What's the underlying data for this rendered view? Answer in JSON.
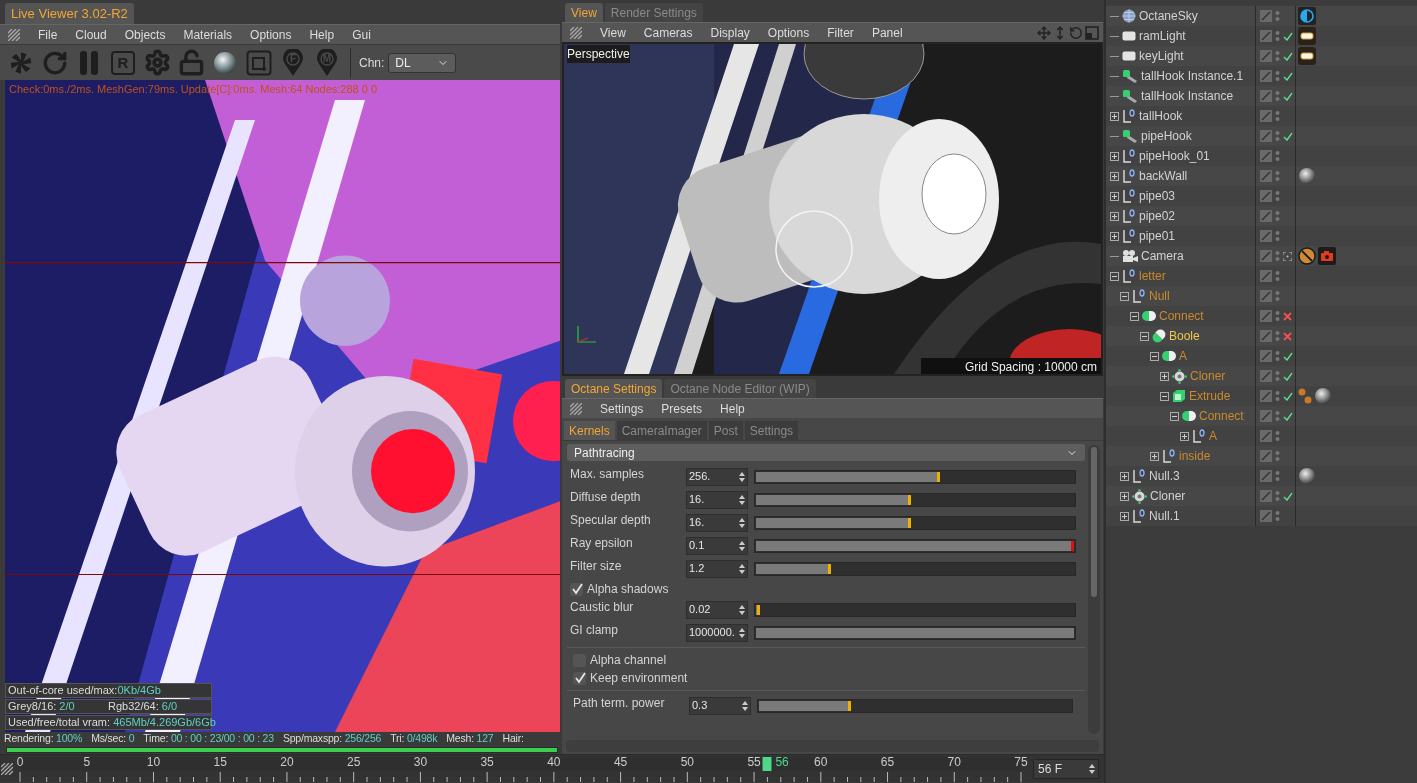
{
  "live_viewer": {
    "tab": {
      "label": "Live Viewer 3.02-R2",
      "selected": true
    },
    "menu": [
      "File",
      "Cloud",
      "Objects",
      "Materials",
      "Options",
      "Help",
      "Gui"
    ],
    "toolbar": [
      {
        "kind": "aperture"
      },
      {
        "kind": "reload"
      },
      {
        "kind": "pause"
      },
      {
        "kind": "letter-box",
        "glyph": "R"
      },
      {
        "kind": "gear"
      },
      {
        "kind": "lock"
      },
      {
        "kind": "sphere"
      },
      {
        "kind": "region"
      },
      {
        "kind": "pin",
        "glyph": "F"
      },
      {
        "kind": "pin",
        "glyph": "M"
      }
    ],
    "channel": {
      "label": "Chn:",
      "value": "DL"
    },
    "overlay": "Check:0ms./2ms. MeshGen:79ms. Update[C]:0ms. Mesh:64 Nodes:288  0 0",
    "stats": [
      [
        {
          "label": "Out-of-core used/max:",
          "value": "0Kb/4Gb"
        }
      ],
      [
        {
          "label": "Grey8/16: ",
          "value": "2/0"
        },
        {
          "label": "Rgb32/64: ",
          "value": "6/0"
        }
      ],
      [
        {
          "label": "Used/free/total vram: ",
          "value": "465Mb/4.269Gb/6Gb"
        }
      ]
    ],
    "status": [
      {
        "label": "Rendering: ",
        "value": "100%"
      },
      {
        "label": "Ms/sec: ",
        "value": "0"
      },
      {
        "label": "Time: ",
        "value": "00 : 00 : 23/00 : 00 : 23"
      },
      {
        "label": "Spp/maxspp: ",
        "value": "256/256"
      },
      {
        "label": "Tri: ",
        "value": "0/498k"
      },
      {
        "label": "Mesh: ",
        "value": "127"
      },
      {
        "label": "Hair:"
      }
    ],
    "progress": {
      "level": 1
    }
  },
  "viewport": {
    "tabs": [
      {
        "label": "View",
        "selected": true
      },
      {
        "label": "Render Settings",
        "selected": false
      }
    ],
    "menu": [
      "View",
      "Cameras",
      "Display",
      "Options",
      "Filter",
      "Panel"
    ],
    "camera": "Perspective",
    "grid": "Grid Spacing : 10000 cm"
  },
  "octane": {
    "tabs": [
      {
        "label": "Octane Settings",
        "selected": true
      },
      {
        "label": "Octane Node Editor (WIP)",
        "selected": false
      }
    ],
    "menu": [
      "Settings",
      "Presets",
      "Help"
    ],
    "subtabs": [
      {
        "label": "Kernels",
        "selected": true
      },
      {
        "label": "CameraImager",
        "selected": false
      },
      {
        "label": "Post",
        "selected": false
      },
      {
        "label": "Settings",
        "selected": false
      }
    ],
    "kernel": "Pathtracing",
    "sections": [
      [
        {
          "kind": "slider",
          "label": "Max. samples",
          "value": "256.",
          "level": 0.58,
          "color": "#f0b000"
        },
        {
          "kind": "slider",
          "label": "Diffuse depth",
          "value": "16.",
          "level": 0.49,
          "color": "#f0b000"
        },
        {
          "kind": "slider",
          "label": "Specular depth",
          "value": "16.",
          "level": 0.49,
          "color": "#f0b000"
        },
        {
          "kind": "slider",
          "label": "Ray epsilon",
          "value": "0.1",
          "level": 1,
          "color": "#e01010"
        },
        {
          "kind": "slider",
          "label": "Filter size",
          "value": "1.2",
          "level": 0.24,
          "color": "#f0b000"
        },
        {
          "kind": "checkbox",
          "label": "Alpha shadows",
          "checked": true
        },
        {
          "kind": "slider",
          "label": "Caustic blur",
          "value": "0.02",
          "level": 0.02,
          "color": "#f0b000"
        },
        {
          "kind": "slider",
          "label": "GI clamp",
          "value": "1000000.",
          "level": 1
        }
      ],
      [
        {
          "kind": "checkbox",
          "label": "Alpha channel",
          "checked": false
        },
        {
          "kind": "checkbox",
          "label": "Keep environment",
          "checked": true
        }
      ],
      [
        {
          "kind": "slider",
          "label": "Path term. power",
          "value": "0.3",
          "level": 0.3,
          "color": "#f0b000"
        }
      ]
    ]
  },
  "objects": [
    {
      "name": "OctaneSky",
      "kind": "sky",
      "selected": false,
      "active": false,
      "tags": [
        {
          "kind": "sky"
        }
      ]
    },
    {
      "name": "ramLight",
      "kind": "light",
      "selected": false,
      "active": false,
      "status": {
        "kind": "check"
      },
      "tags": [
        {
          "kind": "light"
        }
      ]
    },
    {
      "name": "keyLight",
      "kind": "light",
      "selected": false,
      "active": false,
      "status": {
        "kind": "check"
      },
      "tags": [
        {
          "kind": "light"
        }
      ]
    },
    {
      "name": "tallHook Instance.1",
      "kind": "instance",
      "selected": false,
      "active": false,
      "status": {
        "kind": "check"
      }
    },
    {
      "name": "tallHook Instance",
      "kind": "instance",
      "selected": false,
      "active": false,
      "status": {
        "kind": "check"
      }
    },
    {
      "name": "tallHook",
      "kind": "null",
      "selected": false,
      "active": false,
      "expanded": false
    },
    {
      "name": "pipeHook",
      "kind": "instance",
      "selected": false,
      "active": false,
      "status": {
        "kind": "check"
      }
    },
    {
      "name": "pipeHook_01",
      "kind": "null",
      "selected": false,
      "active": false,
      "expanded": false
    },
    {
      "name": "backWall",
      "kind": "null",
      "selected": false,
      "active": false,
      "expanded": false,
      "tags": [
        {
          "kind": "material"
        }
      ]
    },
    {
      "name": "pipe03",
      "kind": "null",
      "selected": false,
      "active": false,
      "expanded": false
    },
    {
      "name": "pipe02",
      "kind": "null",
      "selected": false,
      "active": false,
      "expanded": false
    },
    {
      "name": "pipe01",
      "kind": "null",
      "selected": false,
      "active": false,
      "expanded": false
    },
    {
      "name": "Camera",
      "kind": "camera",
      "selected": false,
      "active": false,
      "status": {
        "kind": "target"
      },
      "tags": [
        {
          "kind": "protection"
        },
        {
          "kind": "camera"
        }
      ]
    },
    {
      "name": "letter",
      "kind": "null",
      "selected": true,
      "active": false,
      "expanded": true,
      "children": [
        {
          "name": "Null",
          "kind": "null",
          "selected": true,
          "active": false,
          "expanded": true,
          "children": [
            {
              "name": "Connect",
              "kind": "connect",
              "selected": true,
              "active": false,
              "expanded": true,
              "status": {
                "kind": "cross"
              },
              "children": [
                {
                  "name": "Boole",
                  "kind": "boole",
                  "selected": true,
                  "active": true,
                  "expanded": true,
                  "status": {
                    "kind": "cross"
                  },
                  "children": [
                    {
                      "name": "A",
                      "kind": "connect",
                      "selected": true,
                      "active": false,
                      "expanded": true,
                      "status": {
                        "kind": "check"
                      },
                      "children": [
                        {
                          "name": "Cloner",
                          "kind": "cloner",
                          "selected": true,
                          "active": false,
                          "expanded": false,
                          "status": {
                            "kind": "check"
                          }
                        },
                        {
                          "name": "Extrude",
                          "kind": "extrude",
                          "selected": true,
                          "active": false,
                          "expanded": true,
                          "status": {
                            "kind": "check"
                          },
                          "tags": [
                            {
                              "kind": "points"
                            },
                            {
                              "kind": "material"
                            }
                          ],
                          "children": [
                            {
                              "name": "Connect",
                              "kind": "connect",
                              "selected": true,
                              "active": false,
                              "expanded": true,
                              "status": {
                                "kind": "check"
                              },
                              "children": [
                                {
                                  "name": "A",
                                  "kind": "null",
                                  "selected": true,
                                  "active": false,
                                  "expanded": false
                                }
                              ]
                            }
                          ]
                        }
                      ]
                    },
                    {
                      "name": "inside",
                      "kind": "null",
                      "selected": true,
                      "active": false,
                      "expanded": false
                    }
                  ]
                }
              ]
            }
          ]
        },
        {
          "name": "Null.3",
          "kind": "null",
          "selected": false,
          "active": false,
          "expanded": false,
          "tags": [
            {
              "kind": "material"
            }
          ]
        },
        {
          "name": "Cloner",
          "kind": "cloner",
          "selected": false,
          "active": false,
          "expanded": false,
          "status": {
            "kind": "check"
          }
        },
        {
          "name": "Null.1",
          "kind": "null",
          "selected": false,
          "active": false,
          "expanded": false
        }
      ]
    }
  ],
  "timeline": {
    "labels": [
      "0",
      "5",
      "10",
      "15",
      "20",
      "25",
      "30",
      "35",
      "40",
      "45",
      "50",
      "55",
      "60",
      "65",
      "70",
      "75"
    ],
    "playhead": {
      "label": "56",
      "level": 0.7467
    },
    "frame": "56 F"
  }
}
